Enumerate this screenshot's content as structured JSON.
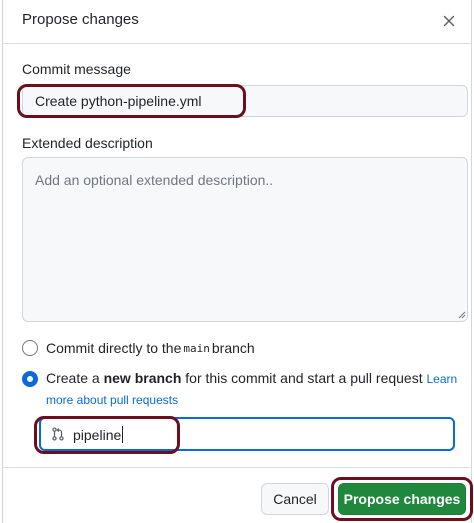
{
  "dialog": {
    "title": "Propose changes",
    "close_label": "×"
  },
  "commit_message": {
    "label": "Commit message",
    "value": "Create python-pipeline.yml"
  },
  "extended_description": {
    "label": "Extended description",
    "placeholder": "Add an optional extended description.."
  },
  "options": {
    "direct": {
      "prefix": "Commit directly to the ",
      "branch_code": "main",
      "suffix": " branch"
    },
    "new_branch": {
      "prefix": "Create a ",
      "bold": "new branch",
      "suffix": " for this commit and start a pull request ",
      "link_part1": "Learn",
      "link_part2": "more about pull requests"
    }
  },
  "branch": {
    "value": "pipeline"
  },
  "footer": {
    "cancel_label": "Cancel",
    "propose_label": "Propose changes"
  },
  "colors": {
    "accent": "#0969da",
    "primary_button": "#1f883d",
    "annotation": "#6b0f1f"
  },
  "icons": {
    "close": "close-icon",
    "branch": "git-pull-request-icon"
  }
}
